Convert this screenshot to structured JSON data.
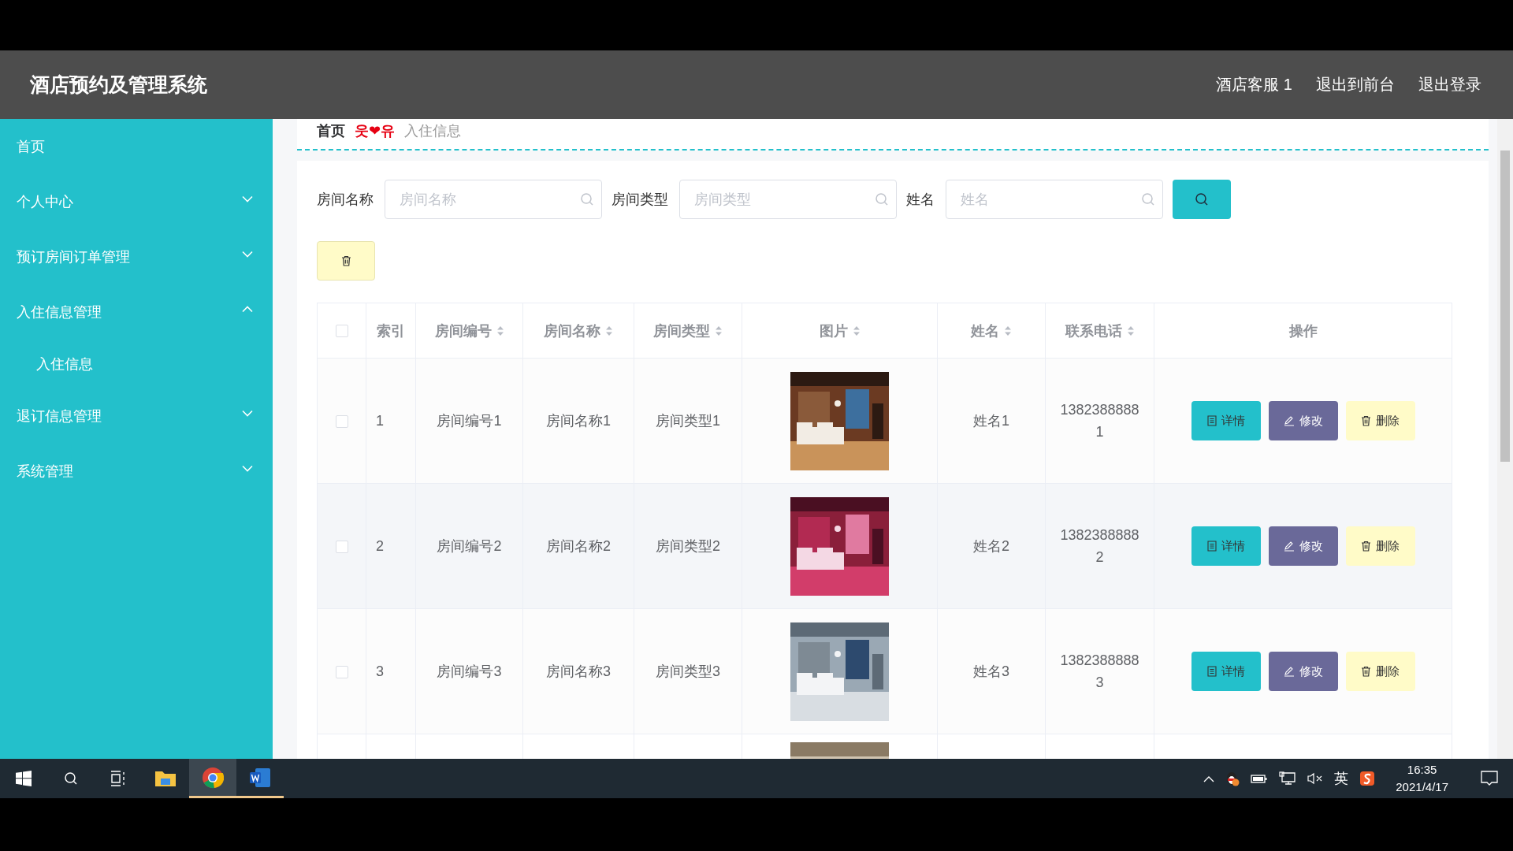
{
  "header": {
    "title": "酒店预约及管理系统",
    "user": "酒店客服 1",
    "links": [
      "退出到前台",
      "退出登录"
    ]
  },
  "sidebar": {
    "home": "首页",
    "menus": [
      {
        "label": "个人中心",
        "expanded": false
      },
      {
        "label": "预订房间订单管理",
        "expanded": false
      },
      {
        "label": "入住信息管理",
        "expanded": true,
        "children": [
          {
            "label": "入住信息"
          }
        ]
      },
      {
        "label": "退订信息管理",
        "expanded": false
      },
      {
        "label": "系统管理",
        "expanded": false
      }
    ]
  },
  "breadcrumb": {
    "home": "首页",
    "separator": "웃❤유",
    "current": "入住信息"
  },
  "search": {
    "fields": [
      {
        "label": "房间名称",
        "placeholder": "房间名称"
      },
      {
        "label": "房间类型",
        "placeholder": "房间类型"
      },
      {
        "label": "姓名",
        "placeholder": "姓名"
      }
    ]
  },
  "table": {
    "select_all": {
      "checked": false
    },
    "columns": [
      {
        "label": "索引",
        "sortable": false
      },
      {
        "label": "房间编号",
        "sortable": true
      },
      {
        "label": "房间名称",
        "sortable": true
      },
      {
        "label": "房间类型",
        "sortable": true
      },
      {
        "label": "图片",
        "sortable": true
      },
      {
        "label": "姓名",
        "sortable": true
      },
      {
        "label": "联系电话",
        "sortable": true
      },
      {
        "label": "操作",
        "sortable": false
      }
    ],
    "rows": [
      {
        "checked": false,
        "index": "1",
        "code": "房间编号1",
        "name": "房间名称1",
        "type": "房间类型1",
        "picture": {
          "kind": "picture"
        },
        "person": "姓名1",
        "phone": "13823888881",
        "actions": [
          {
            "kind": "detail",
            "label": "详情"
          },
          {
            "kind": "edit",
            "label": "修改"
          },
          {
            "kind": "delete",
            "label": "删除"
          }
        ]
      },
      {
        "checked": false,
        "index": "2",
        "code": "房间编号2",
        "name": "房间名称2",
        "type": "房间类型2",
        "picture": {
          "kind": "picture"
        },
        "person": "姓名2",
        "phone": "13823888882",
        "actions": [
          {
            "kind": "detail",
            "label": "详情"
          },
          {
            "kind": "edit",
            "label": "修改"
          },
          {
            "kind": "delete",
            "label": "删除"
          }
        ]
      },
      {
        "checked": false,
        "index": "3",
        "code": "房间编号3",
        "name": "房间名称3",
        "type": "房间类型3",
        "picture": {
          "kind": "picture"
        },
        "person": "姓名3",
        "phone": "13823888883",
        "actions": [
          {
            "kind": "detail",
            "label": "详情"
          },
          {
            "kind": "edit",
            "label": "修改"
          },
          {
            "kind": "delete",
            "label": "删除"
          }
        ]
      },
      {
        "picture": {
          "kind": "picture"
        }
      }
    ]
  },
  "taskbar": {
    "apps": [
      {
        "kind": "explorer",
        "open": false,
        "selected": false
      },
      {
        "kind": "chrome",
        "open": true,
        "selected": true
      },
      {
        "kind": "word",
        "open": true,
        "selected": false
      }
    ],
    "ime": "英",
    "time": "16:35",
    "date": "2021/4/17"
  }
}
